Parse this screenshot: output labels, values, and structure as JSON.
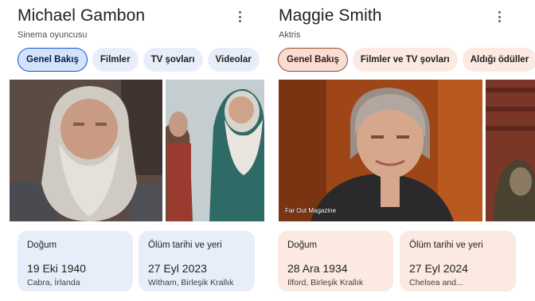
{
  "left": {
    "name": "Michael Gambon",
    "subtitle": "Sinema oyuncusu",
    "chips": [
      "Genel Bakış",
      "Filmler",
      "TV şovları",
      "Videolar"
    ],
    "cards": [
      {
        "label": "Doğum",
        "date": "19 Eki 1940",
        "place": "Cabra, İrlanda"
      },
      {
        "label": "Ölüm tarihi ve yeri",
        "date": "27 Eyl 2023",
        "place": "Witham, Birleşik Krallık"
      }
    ]
  },
  "right": {
    "name": "Maggie Smith",
    "subtitle": "Aktris",
    "chips": [
      "Genel Bakış",
      "Filmler ve TV şovları",
      "Aldığı ödüller"
    ],
    "photo_credit": "Far Out Magazine",
    "cards": [
      {
        "label": "Doğum",
        "date": "28 Ara 1934",
        "place": "Ilford, Birleşik Krallık"
      },
      {
        "label": "Ölüm tarihi ve yeri",
        "date": "27 Eyl 2024",
        "place": "Chelsea and..."
      }
    ]
  },
  "colors": {
    "left_chip_bg": "#e8eef9",
    "left_chip_active_border": "#0b57d0",
    "right_chip_bg": "#fbe9e2",
    "right_chip_active_border": "#9c4a2f",
    "text_primary": "#202124"
  },
  "icons": [
    "more-vert-icon"
  ]
}
